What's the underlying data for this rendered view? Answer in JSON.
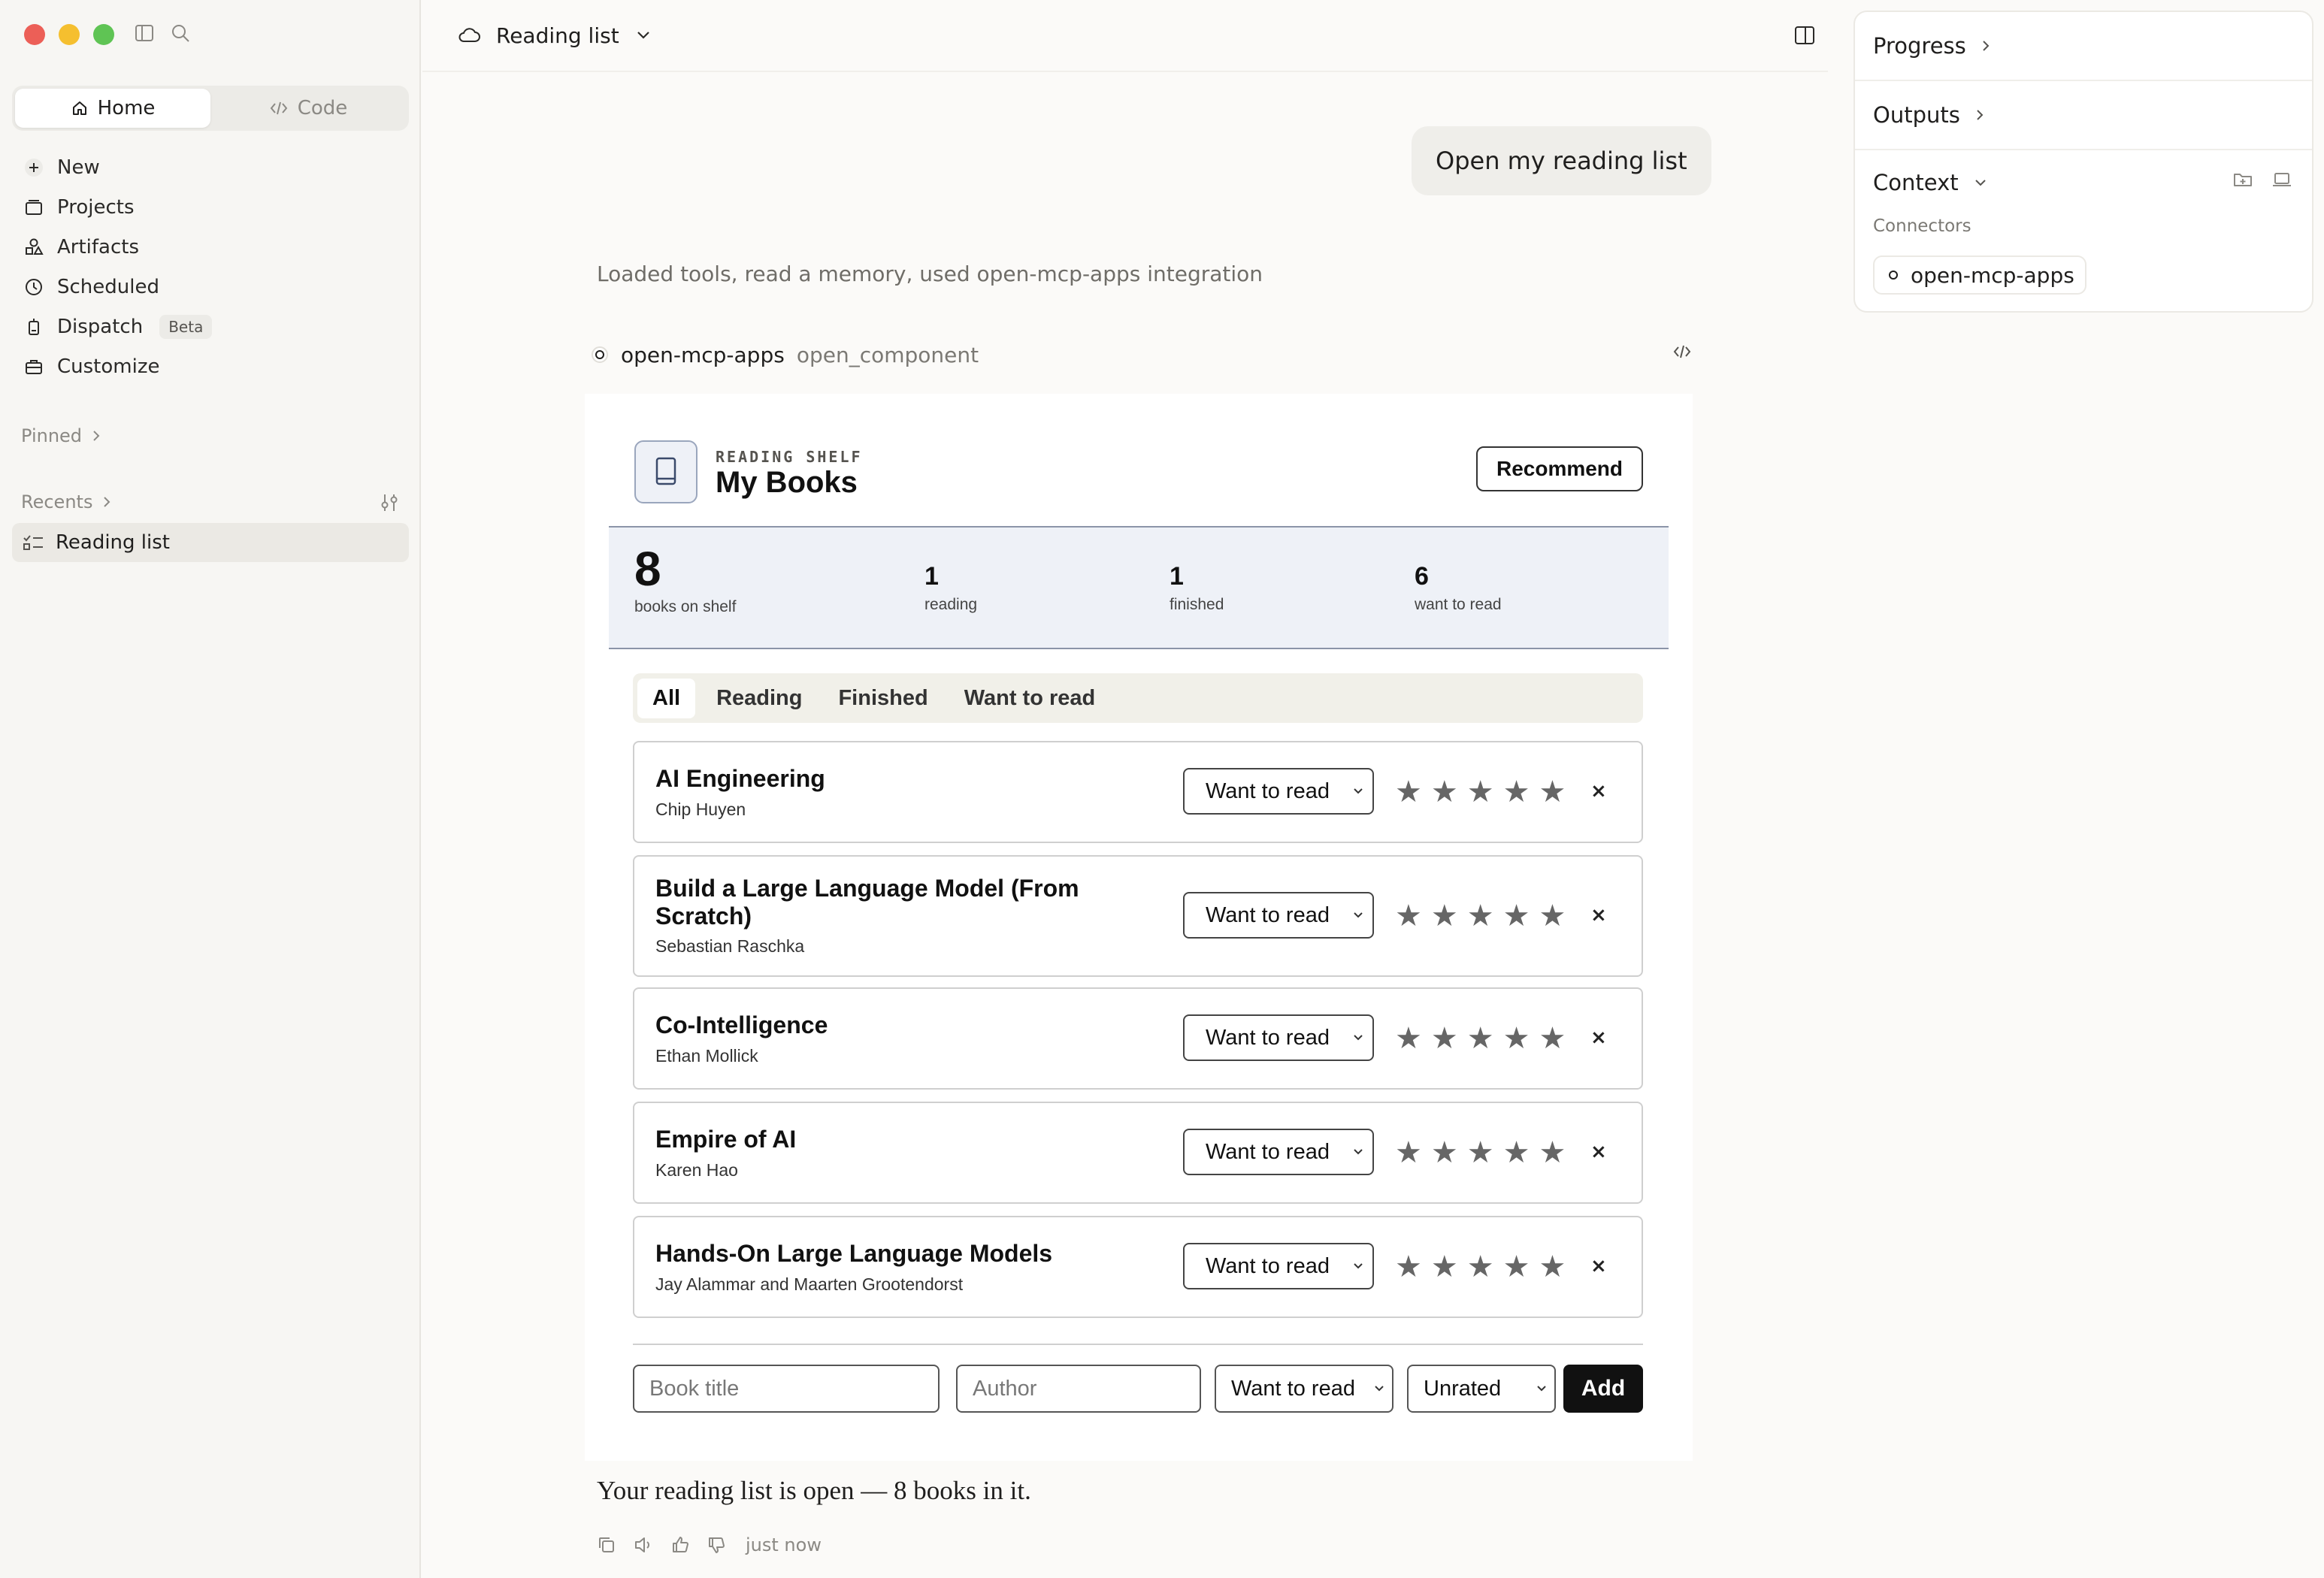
{
  "sidebar": {
    "mode": {
      "home": "Home",
      "code": "Code"
    },
    "nav": [
      {
        "label": "New",
        "icon": "plus-icon"
      },
      {
        "label": "Projects",
        "icon": "projects-icon"
      },
      {
        "label": "Artifacts",
        "icon": "artifacts-icon"
      },
      {
        "label": "Scheduled",
        "icon": "clock-icon"
      },
      {
        "label": "Dispatch",
        "icon": "dispatch-icon",
        "badge": "Beta"
      },
      {
        "label": "Customize",
        "icon": "briefcase-icon"
      }
    ],
    "pinned_label": "Pinned",
    "recents_label": "Recents",
    "recents": [
      {
        "label": "Reading list"
      }
    ]
  },
  "header": {
    "title": "Reading list"
  },
  "conversation": {
    "user_message": "Open my reading list",
    "tools_summary": "Loaded tools, read a memory, used open-mcp-apps integration",
    "tool_call": {
      "server": "open-mcp-apps",
      "function": "open_component"
    },
    "reply": "Your reading list is open — 8 books in it.",
    "timestamp": "just now"
  },
  "app": {
    "kicker": "READING SHELF",
    "title": "My Books",
    "recommend_label": "Recommend",
    "stats": {
      "total": {
        "value": "8",
        "label": "books on shelf"
      },
      "reading": {
        "value": "1",
        "label": "reading"
      },
      "finished": {
        "value": "1",
        "label": "finished"
      },
      "want": {
        "value": "6",
        "label": "want to read"
      }
    },
    "tabs": [
      "All",
      "Reading",
      "Finished",
      "Want to read"
    ],
    "active_tab": "All",
    "books": [
      {
        "title": "AI Engineering",
        "author": "Chip Huyen",
        "status": "Want to read",
        "rating": 0
      },
      {
        "title": "Build a Large Language Model (From Scratch)",
        "author": "Sebastian Raschka",
        "status": "Want to read",
        "rating": 0
      },
      {
        "title": "Co-Intelligence",
        "author": "Ethan Mollick",
        "status": "Want to read",
        "rating": 0
      },
      {
        "title": "Empire of AI",
        "author": "Karen Hao",
        "status": "Want to read",
        "rating": 0
      },
      {
        "title": "Hands-On Large Language Models",
        "author": "Jay Alammar and Maarten Grootendorst",
        "status": "Want to read",
        "rating": 0
      }
    ],
    "star_glyph": "★",
    "remove_glyph": "×",
    "add_form": {
      "title_placeholder": "Book title",
      "author_placeholder": "Author",
      "status_value": "Want to read",
      "rating_value": "Unrated",
      "add_label": "Add"
    }
  },
  "right_panel": {
    "progress": "Progress",
    "outputs": "Outputs",
    "context": "Context",
    "connectors_label": "Connectors",
    "connectors": [
      "open-mcp-apps"
    ]
  },
  "colors": {
    "accent_dark": "#111111",
    "stats_bg": "#eef1f7",
    "sidebar_bg": "#f7f6f3"
  }
}
